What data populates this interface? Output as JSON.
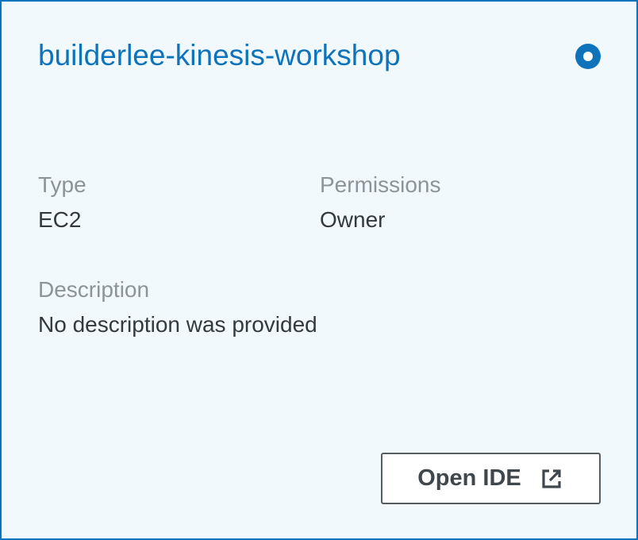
{
  "card": {
    "title": "builderlee-kinesis-workshop",
    "selected": true,
    "accent_color": "#0f73bb",
    "background_color": "#f1f9fd",
    "fields": {
      "type_label": "Type",
      "type_value": "EC2",
      "permissions_label": "Permissions",
      "permissions_value": "Owner",
      "description_label": "Description",
      "description_value": "No description was provided"
    },
    "open_button": {
      "label": "Open IDE",
      "icon": "external-link-icon"
    }
  }
}
